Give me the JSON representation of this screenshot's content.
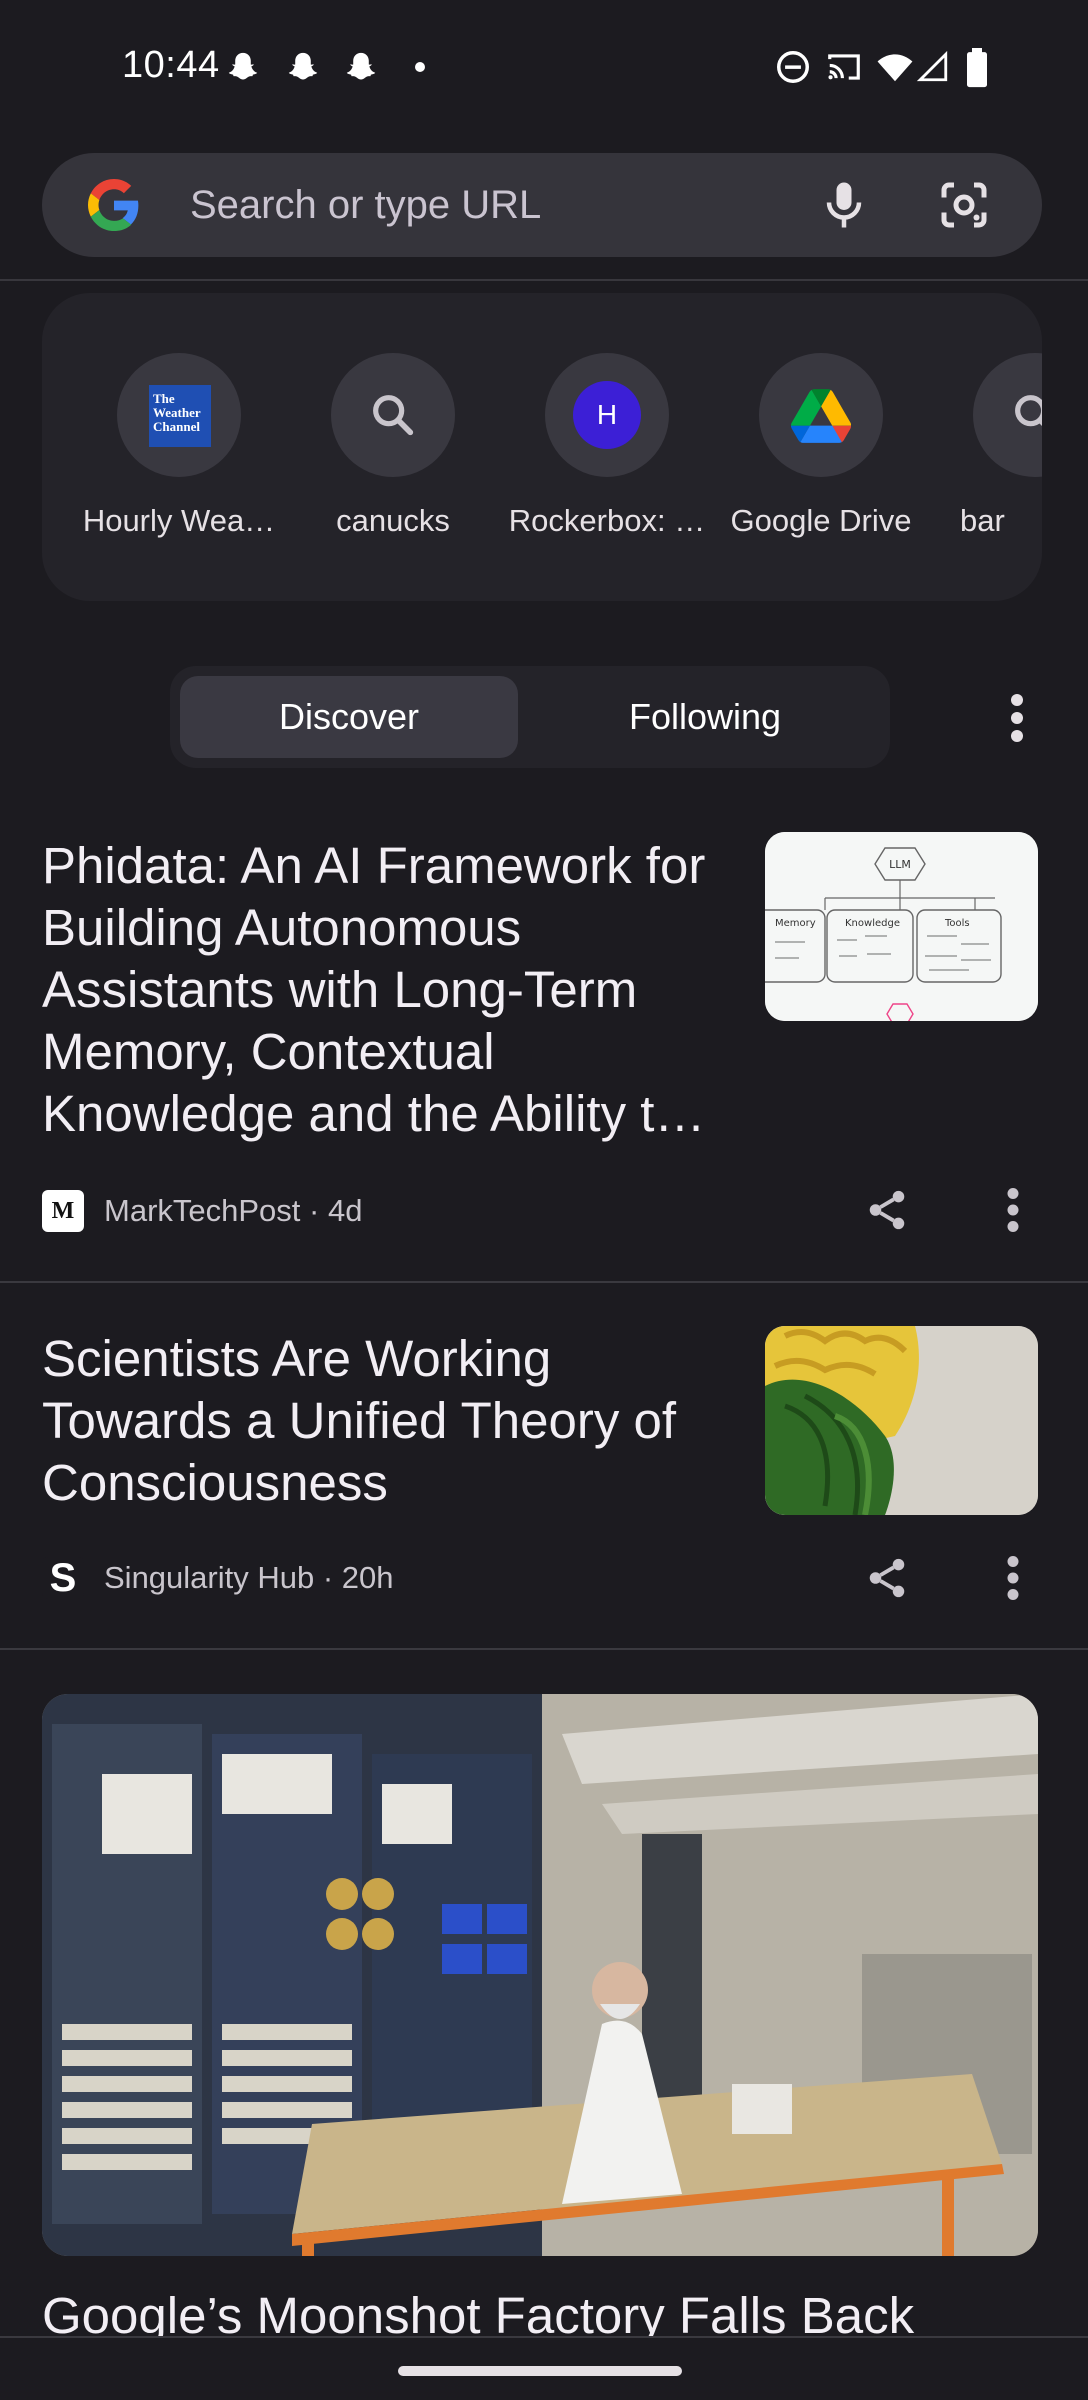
{
  "status_bar": {
    "time": "10:44"
  },
  "search": {
    "placeholder": "Search or type URL"
  },
  "shortcuts": [
    {
      "label": "Hourly Wea…",
      "icon": "weather-channel-logo",
      "logo_text": "The Weather Channel"
    },
    {
      "label": "canucks",
      "icon": "search-icon"
    },
    {
      "label": "Rockerbox: …",
      "icon": "letter-h-icon",
      "letter": "H"
    },
    {
      "label": "Google Drive",
      "icon": "google-drive-logo"
    },
    {
      "label": "bar",
      "icon": "search-icon"
    }
  ],
  "feed_tabs": {
    "discover": "Discover",
    "following": "Following"
  },
  "articles": [
    {
      "title": "Phidata: An AI Framework for Building Autonomous Assistants with Long-Term Memory, Contextual Knowledge and the Ability t…",
      "source": "MarkTechPost · 4d",
      "logo_letter": "M",
      "thumb_labels": [
        "LLM",
        "Knowledge",
        "Tools",
        "Memory"
      ]
    },
    {
      "title": "Scientists Are Working Towards a Unified Theory of Consciousness",
      "source": "Singularity Hub · 20h",
      "logo_letter": "S"
    },
    {
      "title": "Google’s Moonshot Factory Falls Back"
    }
  ],
  "colors": {
    "background": "#1c1b20",
    "search_bar": "#35343b",
    "accent_purple": "#3c1fd6"
  }
}
